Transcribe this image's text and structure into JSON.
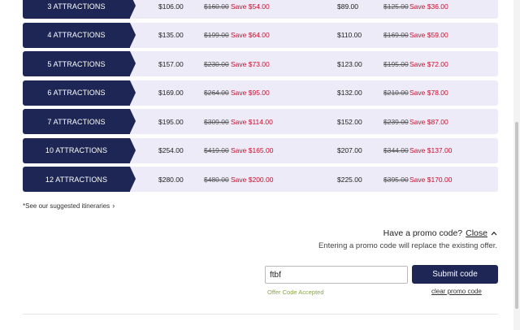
{
  "pricing": {
    "rows": [
      {
        "label": "3 ATTRACTIONS",
        "adult_price": "$106.00",
        "adult_orig": "$160.00",
        "adult_save": "Save $54.00",
        "child_price": "$89.00",
        "child_orig": "$125.00",
        "child_save": "Save $36.00"
      },
      {
        "label": "4 ATTRACTIONS",
        "adult_price": "$135.00",
        "adult_orig": "$199.00",
        "adult_save": "Save $64.00",
        "child_price": "$110.00",
        "child_orig": "$169.00",
        "child_save": "Save $59.00"
      },
      {
        "label": "5 ATTRACTIONS",
        "adult_price": "$157.00",
        "adult_orig": "$230.00",
        "adult_save": "Save $73.00",
        "child_price": "$123.00",
        "child_orig": "$195.00",
        "child_save": "Save $72.00"
      },
      {
        "label": "6 ATTRACTIONS",
        "adult_price": "$169.00",
        "adult_orig": "$264.00",
        "adult_save": "Save $95.00",
        "child_price": "$132.00",
        "child_orig": "$210.00",
        "child_save": "Save $78.00"
      },
      {
        "label": "7 ATTRACTIONS",
        "adult_price": "$195.00",
        "adult_orig": "$309.00",
        "adult_save": "Save $114.00",
        "child_price": "$152.00",
        "child_orig": "$239.00",
        "child_save": "Save $87.00"
      },
      {
        "label": "10 ATTRACTIONS",
        "adult_price": "$254.00",
        "adult_orig": "$419.00",
        "adult_save": "Save $165.00",
        "child_price": "$207.00",
        "child_orig": "$344.00",
        "child_save": "Save $137.00"
      },
      {
        "label": "12 ATTRACTIONS",
        "adult_price": "$280.00",
        "adult_orig": "$480.00",
        "adult_save": "Save $200.00",
        "child_price": "$225.00",
        "child_orig": "$395.00",
        "child_save": "Save $170.00"
      }
    ]
  },
  "itineraries_link": "*See our suggested itineraries",
  "promo": {
    "question": "Have a promo code?",
    "close_label": "Close",
    "note": "Entering a promo code will replace the existing offer.",
    "input_value": "ftbf",
    "submit_label": "Submit code",
    "status": "Offer Code Accepted",
    "clear_label": "clear promo code"
  },
  "icons": {
    "itineraries": "chevron-right-icon",
    "close": "chevron-up-icon"
  },
  "colors": {
    "navy": "#1d2654",
    "row_bg": "#ecebf7",
    "save_red": "#c8102e",
    "accepted_green": "#8aa64a"
  }
}
